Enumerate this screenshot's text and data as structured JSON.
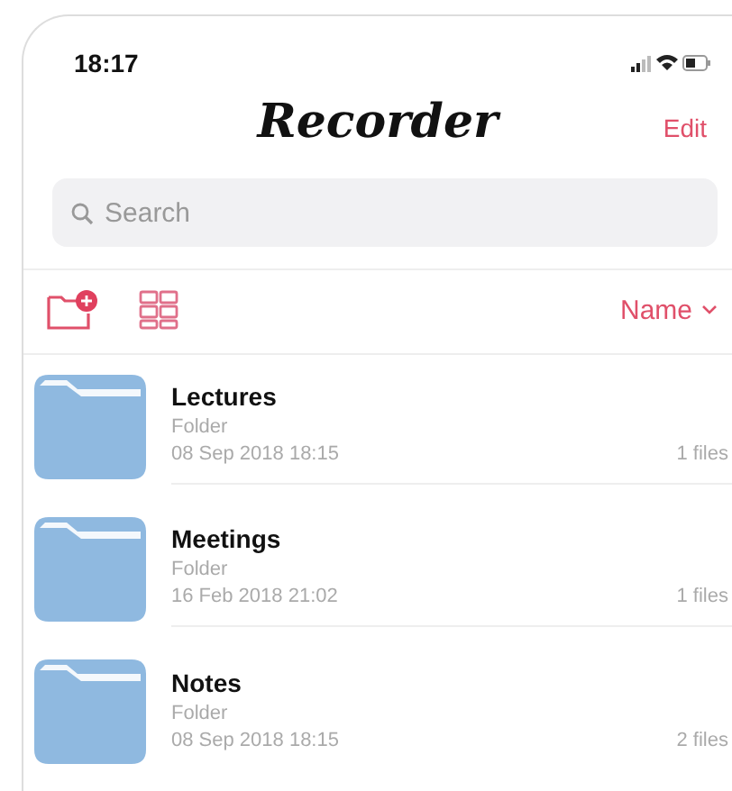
{
  "status_bar": {
    "time": "18:17"
  },
  "nav": {
    "title": "Recorder",
    "edit": "Edit"
  },
  "search": {
    "placeholder": "Search"
  },
  "toolbar": {
    "sort": "Name"
  },
  "folders": [
    {
      "name": "Lectures",
      "type": "Folder",
      "date": "08 Sep 2018 18:15",
      "count": "1 files"
    },
    {
      "name": "Meetings",
      "type": "Folder",
      "date": "16 Feb 2018 21:02",
      "count": "1 files"
    },
    {
      "name": "Notes",
      "type": "Folder",
      "date": "08 Sep 2018 18:15",
      "count": "2 files"
    }
  ]
}
